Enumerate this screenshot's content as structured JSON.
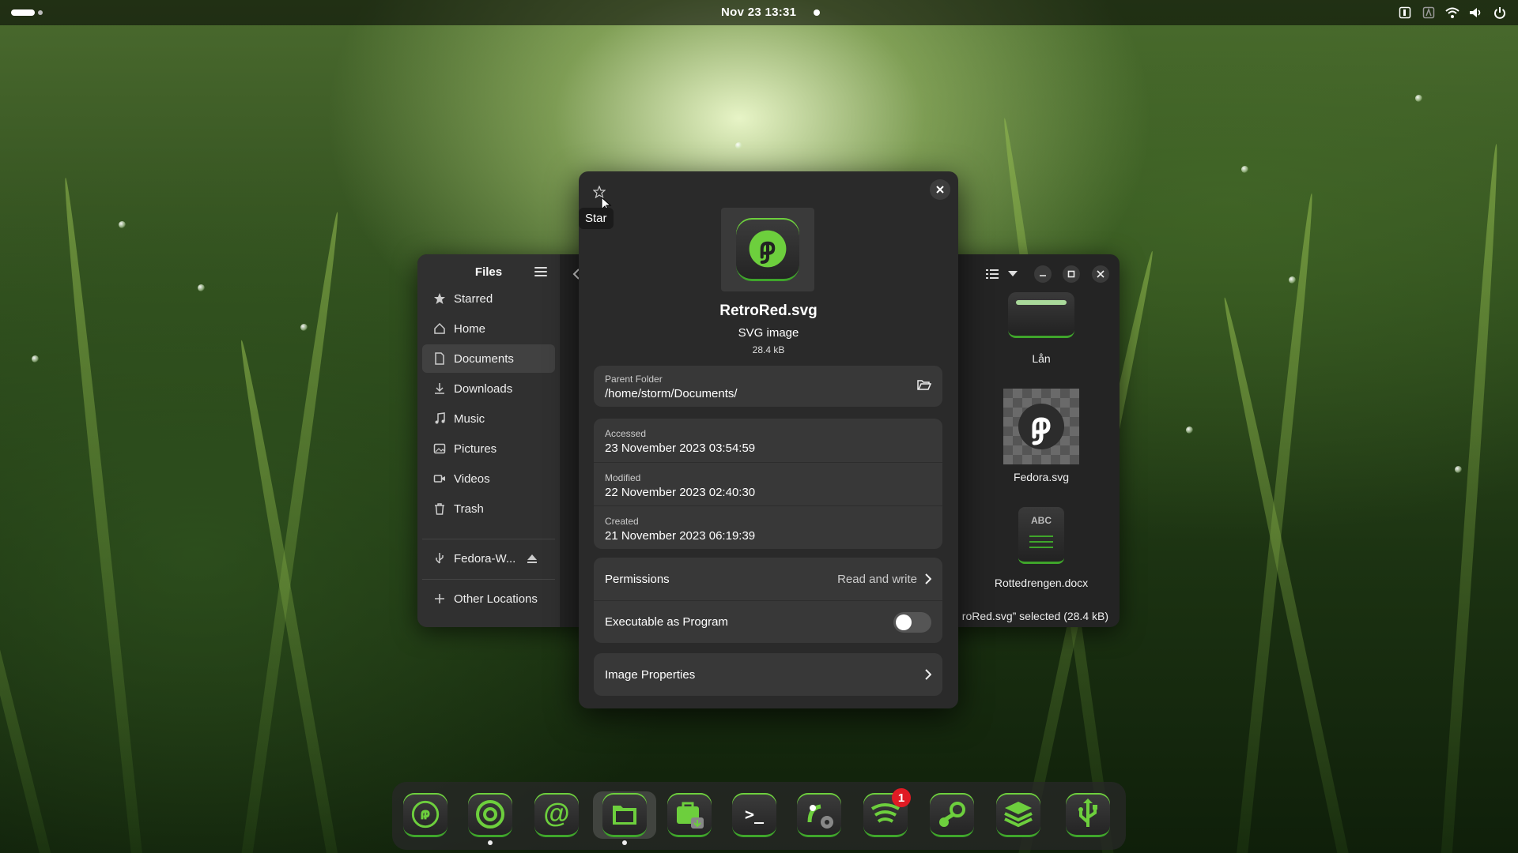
{
  "topbar": {
    "clock": "Nov 23  13:31"
  },
  "files_window": {
    "title": "Files",
    "sidebar": [
      {
        "label": "Starred",
        "icon": "star-icon"
      },
      {
        "label": "Home",
        "icon": "home-icon"
      },
      {
        "label": "Documents",
        "icon": "document-icon",
        "active": true
      },
      {
        "label": "Downloads",
        "icon": "download-icon"
      },
      {
        "label": "Music",
        "icon": "music-icon"
      },
      {
        "label": "Pictures",
        "icon": "picture-icon"
      },
      {
        "label": "Videos",
        "icon": "video-icon"
      },
      {
        "label": "Trash",
        "icon": "trash-icon"
      }
    ],
    "device": {
      "label": "Fedora-W...",
      "icon": "usb-icon"
    },
    "other_locations": "Other Locations",
    "files": [
      {
        "name": "Lån",
        "icon": "folder-icon"
      },
      {
        "name": "Fedora.svg",
        "icon": "fedora-icon"
      },
      {
        "name": "Rottedrengen.docx",
        "icon": "document-abc-icon"
      }
    ],
    "status": "roRed.svg” selected  (28.4 kB)"
  },
  "properties_dialog": {
    "tooltip": "Star",
    "file_name": "RetroRed.svg",
    "file_type": "SVG image",
    "file_size": "28.4 kB",
    "parent_folder": {
      "label": "Parent Folder",
      "value": "/home/storm/Documents/"
    },
    "dates": [
      {
        "label": "Accessed",
        "value": "23 November 2023 03:54:59"
      },
      {
        "label": "Modified",
        "value": "22 November 2023 02:40:30"
      },
      {
        "label": "Created",
        "value": "21 November 2023 06:19:39"
      }
    ],
    "permissions": {
      "label": "Permissions",
      "value": "Read and write"
    },
    "executable": {
      "label": "Executable as Program",
      "enabled": false
    },
    "image_properties": "Image Properties"
  },
  "dock": {
    "apps": [
      {
        "name": "fedora-icon"
      },
      {
        "name": "browser-icon",
        "running": true
      },
      {
        "name": "mail-icon"
      },
      {
        "name": "files-icon",
        "running": true,
        "active": true
      },
      {
        "name": "software-icon"
      },
      {
        "name": "terminal-icon"
      },
      {
        "name": "settings-icon"
      },
      {
        "name": "rss-icon",
        "badge": "1"
      },
      {
        "name": "steam-icon"
      },
      {
        "name": "stack-icon"
      },
      {
        "name": "usb-writer-icon"
      }
    ]
  },
  "colors": {
    "accent": "#3fa52b",
    "badge": "#e01b24",
    "window_bg": "#242424",
    "dialog_bg": "#2a2a2a"
  }
}
